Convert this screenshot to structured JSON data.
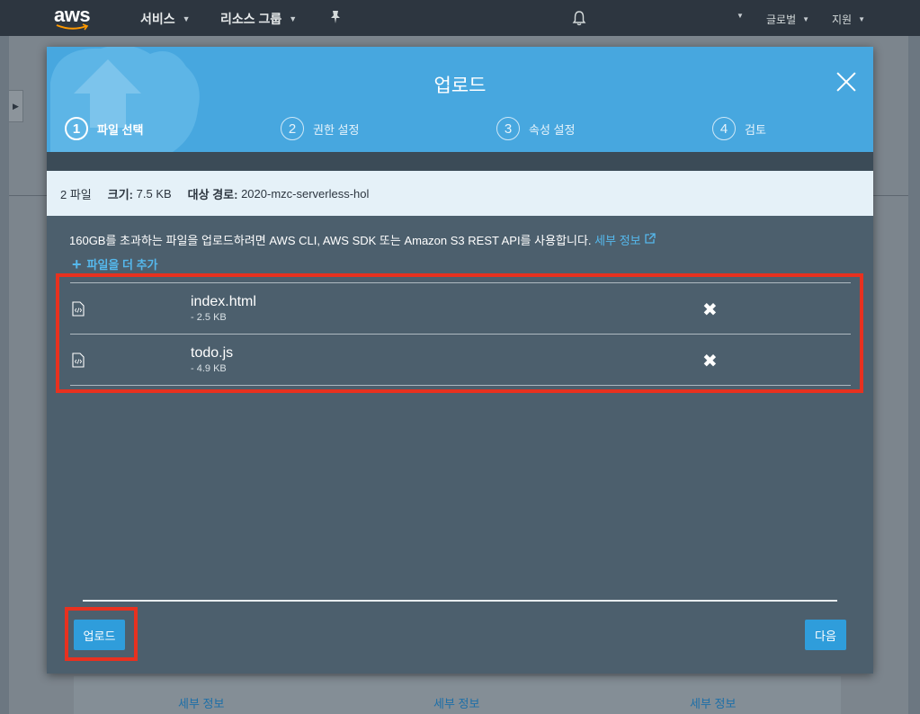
{
  "topnav": {
    "logo_text": "aws",
    "services": "서비스",
    "resource_groups": "리소스 그룹",
    "region": "글로벌",
    "support": "지원"
  },
  "modal": {
    "title": "업로드",
    "steps": [
      {
        "num": "1",
        "label": "파일 선택"
      },
      {
        "num": "2",
        "label": "권한 설정"
      },
      {
        "num": "3",
        "label": "속성 설정"
      },
      {
        "num": "4",
        "label": "검토"
      }
    ],
    "summary": {
      "file_count": "2 파일",
      "size_label": "크기:",
      "size_value": "7.5 KB",
      "dest_label": "대상 경로:",
      "dest_value": "2020-mzc-serverless-hol"
    },
    "note_text": "160GB를 초과하는 파일을 업로드하려면 AWS CLI, AWS SDK 또는 Amazon S3 REST API를 사용합니다.",
    "note_link": "세부 정보",
    "add_more": "파일을 더 추가",
    "files": [
      {
        "name": "index.html",
        "size": "- 2.5 KB"
      },
      {
        "name": "todo.js",
        "size": "- 4.9 KB"
      }
    ],
    "upload_button": "업로드",
    "next_button": "다음"
  },
  "background": {
    "footer_links": [
      "세부 정보",
      "세부 정보",
      "세부 정보"
    ]
  },
  "colors": {
    "header_blue": "#47a7df",
    "modal_body": "#4c5f6d",
    "button_blue": "#2f9ddb",
    "highlight_red": "#e8311f",
    "link_blue": "#55b8ec"
  }
}
